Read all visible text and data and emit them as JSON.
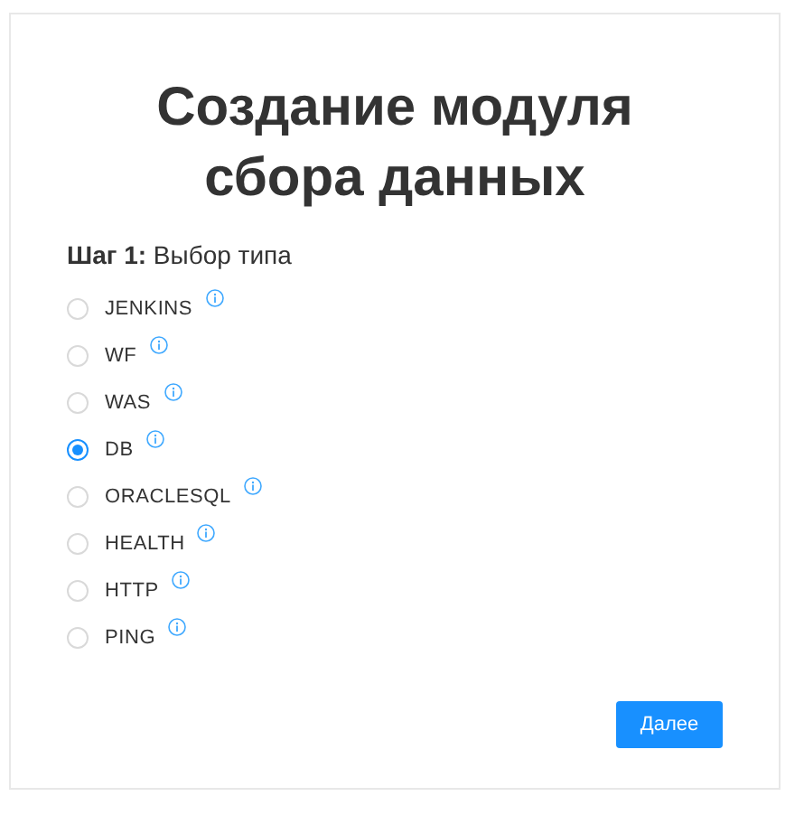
{
  "title": "Создание модуля сбора данных",
  "step_label": "**Шаг 1:** Выбор типа",
  "options": [
    {
      "label": "JENKINS",
      "selected": false
    },
    {
      "label": "WF",
      "selected": false
    },
    {
      "label": "WAS",
      "selected": false
    },
    {
      "label": "DB",
      "selected": true
    },
    {
      "label": "ORACLESQL",
      "selected": false
    },
    {
      "label": "HEALTH",
      "selected": false
    },
    {
      "label": "HTTP",
      "selected": false
    },
    {
      "label": "PING",
      "selected": false
    }
  ],
  "next_button": "Далее"
}
